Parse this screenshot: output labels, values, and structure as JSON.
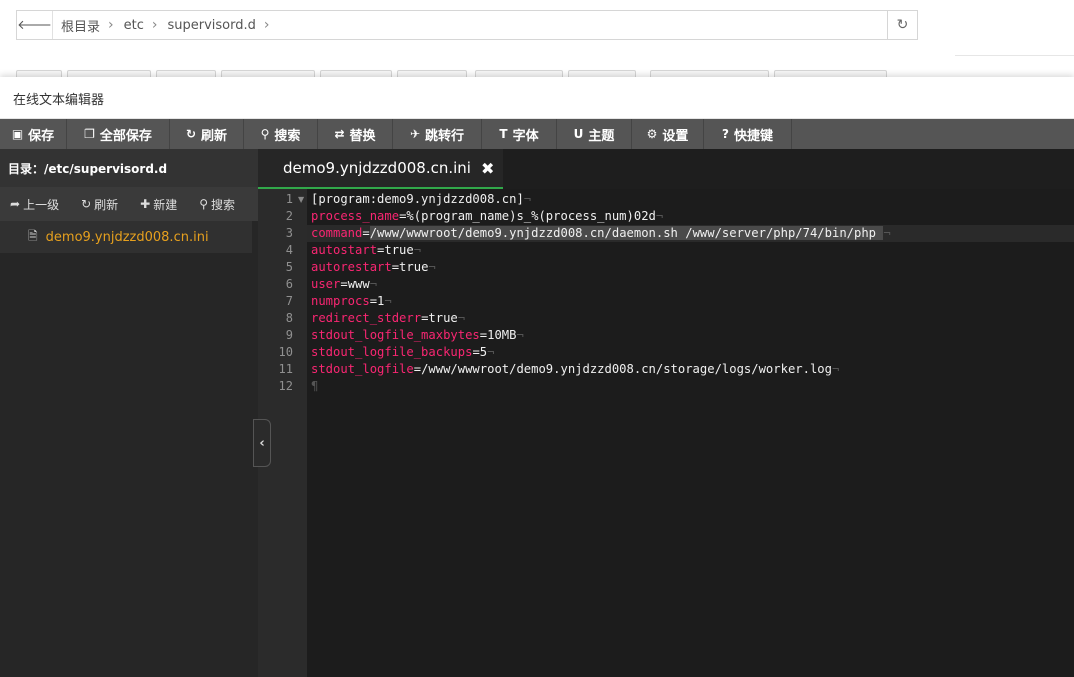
{
  "file_manager": {
    "breadcrumbs": [
      "根目录",
      "etc",
      "supervisord.d"
    ],
    "back_icon": "arrow-left-icon",
    "refresh_icon": "refresh-icon"
  },
  "editor": {
    "window_title": "在线文本编辑器",
    "toolbar": [
      {
        "id": "save",
        "icon": "save-icon",
        "glyph": "▣",
        "label": "保存"
      },
      {
        "id": "save-all",
        "icon": "save-all-icon",
        "glyph": "❐",
        "label": "全部保存"
      },
      {
        "id": "refresh",
        "icon": "refresh-icon",
        "glyph": "↻",
        "label": "刷新"
      },
      {
        "id": "search",
        "icon": "search-icon",
        "glyph": "⚲",
        "label": "搜索"
      },
      {
        "id": "replace",
        "icon": "replace-icon",
        "glyph": "⇄",
        "label": "替换"
      },
      {
        "id": "goto",
        "icon": "pin-icon",
        "glyph": "✈",
        "label": "跳转行"
      },
      {
        "id": "font",
        "icon": "font-icon",
        "glyph": "T",
        "label": "字体"
      },
      {
        "id": "theme",
        "icon": "magnet-icon",
        "glyph": "U",
        "label": "主题"
      },
      {
        "id": "settings",
        "icon": "gear-icon",
        "glyph": "⚙",
        "label": "设置"
      },
      {
        "id": "shortcuts",
        "icon": "question-icon",
        "glyph": "?",
        "label": "快捷键"
      }
    ],
    "sidebar": {
      "directory_label": "目录：/etc/supervisord.d",
      "tools": [
        {
          "id": "up",
          "icon": "share-icon",
          "glyph": "➦",
          "label": "上一级"
        },
        {
          "id": "refresh",
          "icon": "refresh-icon",
          "glyph": "↻",
          "label": "刷新"
        },
        {
          "id": "new",
          "icon": "plus-icon",
          "glyph": "✚",
          "label": "新建"
        },
        {
          "id": "search",
          "icon": "search-icon",
          "glyph": "⚲",
          "label": "搜索"
        }
      ],
      "files": [
        {
          "icon": "file-icon",
          "name": "demo9.ynjdzzd008.cn.ini"
        }
      ]
    },
    "tab": {
      "label": "demo9.ynjdzzd008.cn.ini",
      "close_glyph": "✖"
    },
    "code_lines": [
      {
        "n": "1",
        "key": "",
        "rest": "[program:demo9.ynjdzzd008.cn]"
      },
      {
        "n": "2",
        "key": "process_name",
        "rest": "=%(program_name)s_%(process_num)02d"
      },
      {
        "n": "3",
        "key": "command",
        "rest": "=/www/wwwroot/demo9.ynjdzzd008.cn/daemon.sh /www/server/php/74/bin/php "
      },
      {
        "n": "4",
        "key": "autostart",
        "rest": "=true"
      },
      {
        "n": "5",
        "key": "autorestart",
        "rest": "=true"
      },
      {
        "n": "6",
        "key": "user",
        "rest": "=www"
      },
      {
        "n": "7",
        "key": "numprocs",
        "rest": "=1"
      },
      {
        "n": "8",
        "key": "redirect_stderr",
        "rest": "=true"
      },
      {
        "n": "9",
        "key": "stdout_logfile_maxbytes",
        "rest": "=10MB"
      },
      {
        "n": "10",
        "key": "stdout_logfile_backups",
        "rest": "=5"
      },
      {
        "n": "11",
        "key": "stdout_logfile",
        "rest": "=/www/wwwroot/demo9.ynjdzzd008.cn/storage/logs/worker.log"
      },
      {
        "n": "12",
        "key": "",
        "rest": ""
      }
    ],
    "eol_mark": "¬",
    "eof_mark": "¶"
  }
}
